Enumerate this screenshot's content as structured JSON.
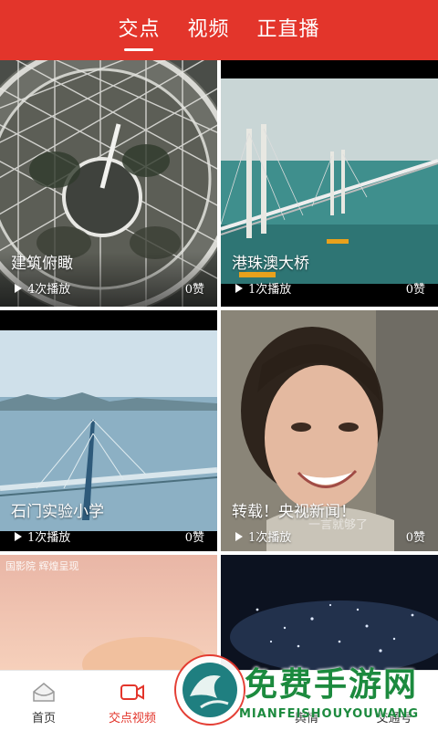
{
  "header": {
    "tabs": [
      {
        "label": "交点",
        "active": true
      },
      {
        "label": "视频",
        "active": false
      },
      {
        "label": "正直播",
        "active": false
      }
    ]
  },
  "feed": {
    "cards": [
      {
        "title": "建筑俯瞰",
        "plays": "4次播放",
        "likes": "0赞"
      },
      {
        "title": "港珠澳大桥",
        "plays": "1次播放",
        "likes": "0赞"
      },
      {
        "title": "石门实验小学",
        "plays": "1次播放",
        "likes": "0赞"
      },
      {
        "title": "转载！央视新闻！",
        "plays": "1次播放",
        "likes": "0赞",
        "subtitle": "一言就够了"
      },
      {
        "title": "",
        "plays": "",
        "likes": "",
        "overlay_text": "国影院 辉煌呈现"
      },
      {
        "title": "",
        "plays": "",
        "likes": ""
      }
    ]
  },
  "bottom_nav": {
    "items": [
      {
        "label": "首页",
        "icon": "home-icon",
        "active": false
      },
      {
        "label": "交点视频",
        "icon": "video-camera-icon",
        "active": true
      },
      {
        "label": "舆情",
        "icon": "news-icon",
        "active": false
      },
      {
        "label": "交通号",
        "icon": "account-icon",
        "active": false
      }
    ]
  },
  "watermark": {
    "text": "免费手游网",
    "sub": "MIANFEISHOUYOUWANG"
  },
  "colors": {
    "brand_red": "#e3352b",
    "watermark_green": "#1c8a3e"
  }
}
